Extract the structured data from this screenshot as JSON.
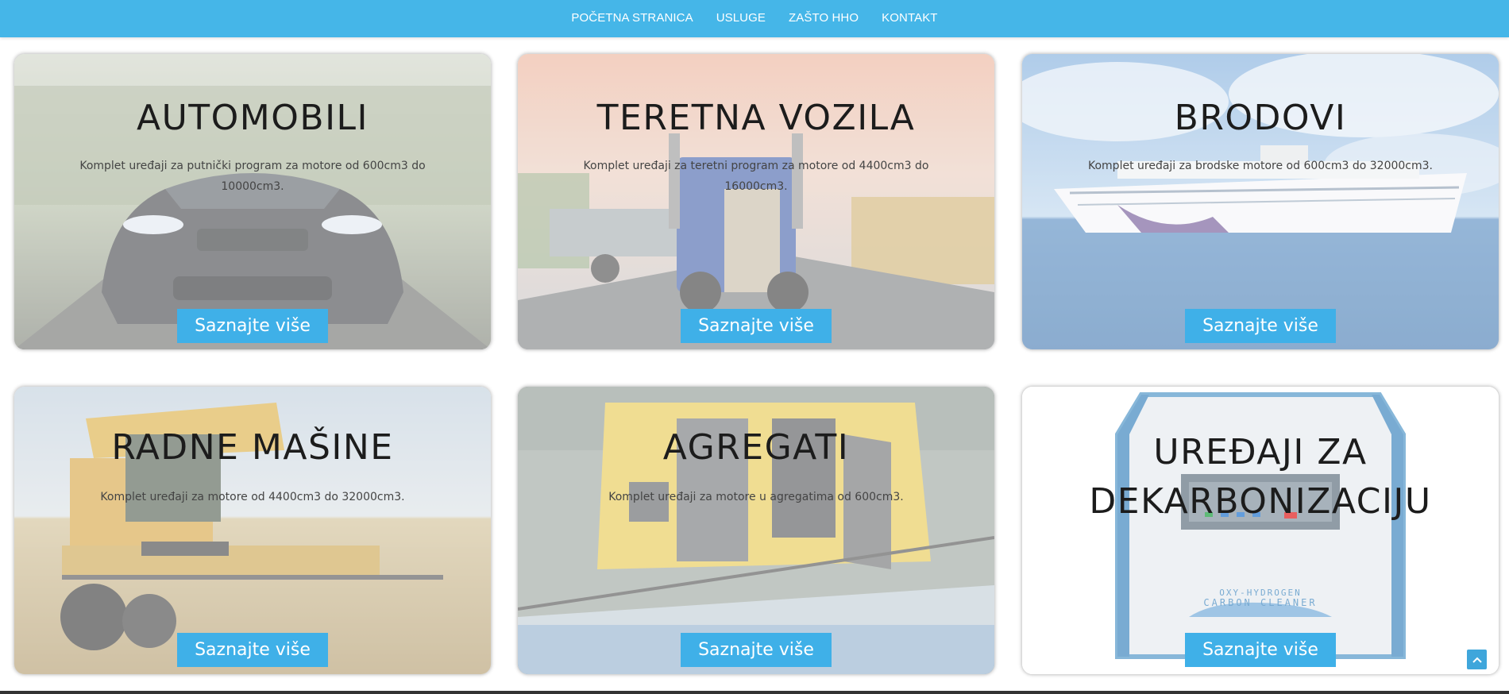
{
  "nav": {
    "items": [
      "POČETNA STRANICA",
      "USLUGE",
      "ZAŠTO HHO",
      "KONTAKT"
    ]
  },
  "cards": [
    {
      "title": "AUTOMOBILI",
      "description": "Komplet uređaji za putnički program za motore od 600cm3 do 10000cm3.",
      "button": "Saznajte više",
      "image": "car-photo"
    },
    {
      "title": "TERETNA VOZILA",
      "description": "Komplet uređaji za teretni program za motore od 4400cm3 do 16000cm3.",
      "button": "Saznajte više",
      "image": "truck-photo"
    },
    {
      "title": "BRODOVI",
      "description": "Komplet uređaji za brodske motore od 600cm3 do 32000cm3.",
      "button": "Saznajte više",
      "image": "cruise-ship-photo"
    },
    {
      "title": "RADNE MAŠINE",
      "description": "Komplet uređaji za motore od 4400cm3 do 32000cm3.",
      "button": "Saznajte više",
      "image": "combine-harvester-photo"
    },
    {
      "title": "AGREGATI",
      "description": "Komplet uređaji za motore u agregatima od 600cm3.",
      "button": "Saznajte više",
      "image": "generator-photo"
    },
    {
      "title": "UREĐAJI ZA DEKARBONIZACIJU",
      "description": "",
      "button": "Saznajte više",
      "image": "carbon-cleaner-machine-photo",
      "machine_label_1": "OXY-HYDROGEN",
      "machine_label_2": "CARBON CLEANER"
    }
  ],
  "scroll_top": {
    "icon": "chevron-up-icon"
  },
  "colors": {
    "nav_bg": "#45b6e8",
    "button_bg": "#3fb0e8",
    "title": "#1c1c1c"
  }
}
